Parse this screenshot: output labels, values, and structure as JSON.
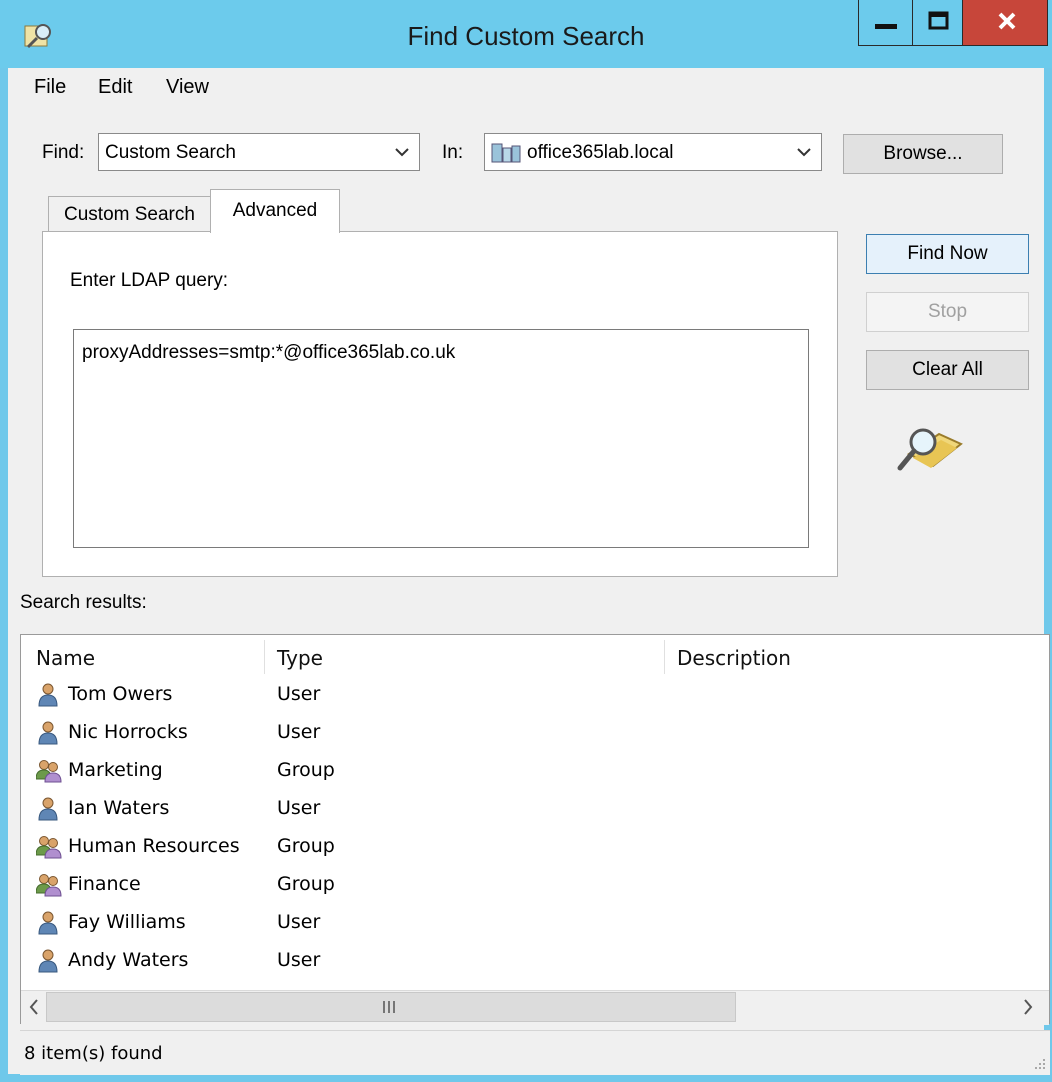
{
  "window": {
    "title": "Find Custom Search"
  },
  "menu": {
    "items": [
      "File",
      "Edit",
      "View"
    ]
  },
  "find": {
    "label": "Find:",
    "value": "Custom Search"
  },
  "in": {
    "label": "In:",
    "value": "office365lab.local"
  },
  "buttons": {
    "browse": "Browse...",
    "find_now": "Find Now",
    "stop": "Stop",
    "clear_all": "Clear All"
  },
  "tabs": [
    {
      "label": "Custom Search",
      "active": false
    },
    {
      "label": "Advanced",
      "active": true
    }
  ],
  "advanced": {
    "prompt": "Enter LDAP query:",
    "query": "proxyAddresses=smtp:*@office365lab.co.uk"
  },
  "results": {
    "label": "Search results:",
    "columns": [
      "Name",
      "Type",
      "Description"
    ],
    "rows": [
      {
        "name": "Tom Owers",
        "type": "User",
        "icon": "user-icon"
      },
      {
        "name": "Nic Horrocks",
        "type": "User",
        "icon": "user-icon"
      },
      {
        "name": "Marketing",
        "type": "Group",
        "icon": "group-icon"
      },
      {
        "name": "Ian Waters",
        "type": "User",
        "icon": "user-icon"
      },
      {
        "name": "Human Resources",
        "type": "Group",
        "icon": "group-icon"
      },
      {
        "name": "Finance",
        "type": "Group",
        "icon": "group-icon"
      },
      {
        "name": "Fay Williams",
        "type": "User",
        "icon": "user-icon"
      },
      {
        "name": "Andy Waters",
        "type": "User",
        "icon": "user-icon"
      }
    ]
  },
  "status": {
    "text": "8 item(s) found"
  },
  "colors": {
    "titlebar": "#6ccbec",
    "close": "#c7463a",
    "window_bg": "#f0f0f0"
  }
}
